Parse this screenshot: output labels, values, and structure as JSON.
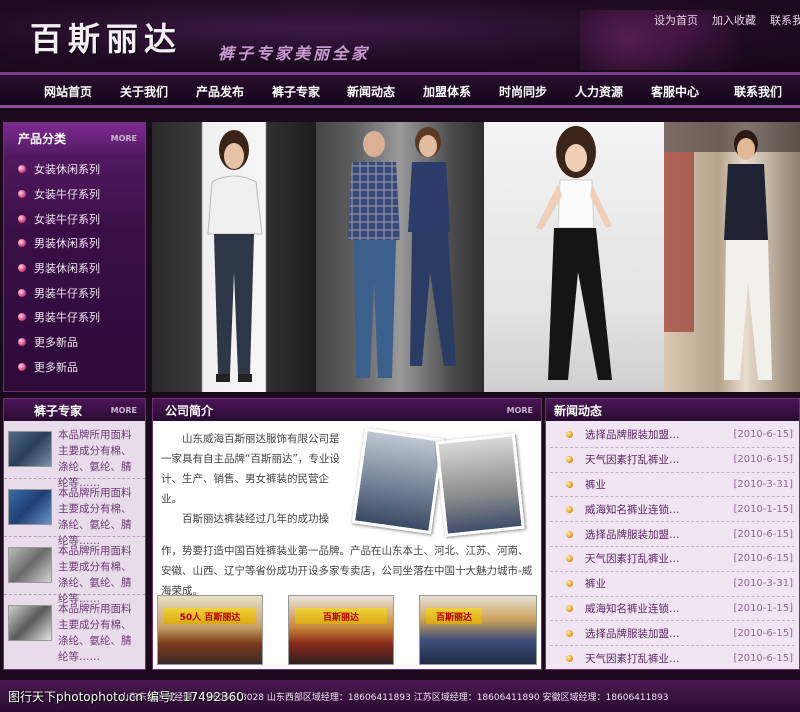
{
  "header": {
    "logo": "百斯丽达",
    "slogan": "裤子专家美丽全家",
    "top_links": [
      "设为首页",
      "加入收藏",
      "联系我们"
    ]
  },
  "nav": [
    "网站首页",
    "关于我们",
    "产品发布",
    "裤子专家",
    "新闻动态",
    "加盟体系",
    "时尚同步",
    "人力资源",
    "客服中心",
    "联系我们"
  ],
  "categories": {
    "title": "产品分类",
    "more": "MORE",
    "items": [
      "女装休闲系列",
      "女装牛仔系列",
      "女装牛仔系列",
      "男装休闲系列",
      "男装休闲系列",
      "男装牛仔系列",
      "男装牛仔系列",
      "更多新品",
      "更多新品"
    ]
  },
  "expert": {
    "title": "裤子专家",
    "more": "MORE",
    "items": [
      "本品牌所用面料主要成分有棉、涤纶、氨纶、腈纶等……",
      "本品牌所用面料主要成分有棉、涤纶、氨纶、腈纶等……",
      "本品牌所用面料主要成分有棉、涤纶、氨纶、腈纶等……",
      "本品牌所用面料主要成分有棉、涤纶、氨纶、腈纶等……"
    ]
  },
  "intro": {
    "title": "公司简介",
    "more": "MORE",
    "para1": "山东威海百斯丽达服饰有限公司是一家具有自主品牌“百斯丽达”，专业设计、生产、销售、男女裤装的民营企业。",
    "para2a": "百斯丽达裤装经过几年的成功操",
    "para2b": "作，势要打造中国百姓裤装业第一品牌。产品在山东本土、河北、江苏、河南、安徽、山西、辽宁等省份成功开设多家专卖店，公司坐落在中国十大魅力城市-威海荣成。",
    "stores": [
      "50人 百斯丽达",
      "百斯丽达",
      "百斯丽达"
    ]
  },
  "news": {
    "title": "新闻动态",
    "items": [
      {
        "title": "选择品牌服装加盟…",
        "date": "[2010-6-15]"
      },
      {
        "title": "天气因素打乱裤业…",
        "date": "[2010-6-15]"
      },
      {
        "title": "裤业",
        "date": "[2010-3-31]"
      },
      {
        "title": "威海知名裤业连锁…",
        "date": "[2010-1-15]"
      },
      {
        "title": "选择品牌服装加盟…",
        "date": "[2010-6-15]"
      },
      {
        "title": "天气因素打乱裤业…",
        "date": "[2010-6-15]"
      },
      {
        "title": "裤业",
        "date": "[2010-3-31]"
      },
      {
        "title": "威海知名裤业连锁…",
        "date": "[2010-1-15]"
      },
      {
        "title": "选择品牌服装加盟…",
        "date": "[2010-6-15]"
      },
      {
        "title": "天气因素打乱裤业…",
        "date": "[2010-6-15]"
      }
    ]
  },
  "footer": {
    "text": "山东东部区域经理：18606113028  山东西部区域经理：18606411893  江苏区域经理：18606411890  安徽区域经理：18606411893"
  },
  "watermark": "图行天下photophoto.cn 编号：17492360"
}
